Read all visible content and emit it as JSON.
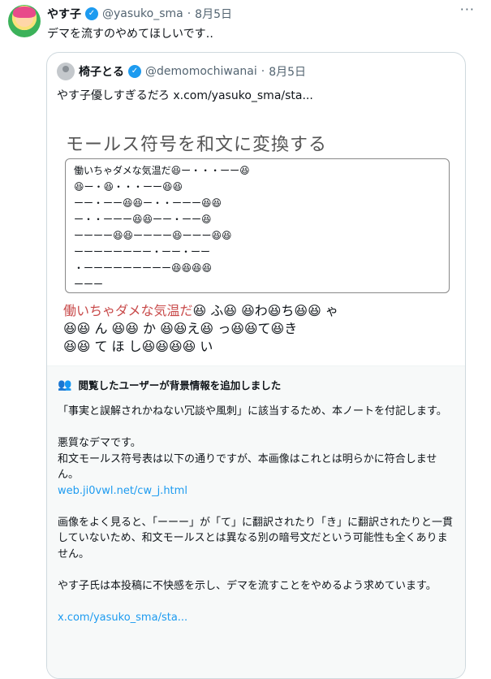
{
  "tweet": {
    "name": "やす子",
    "handle": "@yasuko_sma",
    "date": "8月5日",
    "text": "デマを流すのやめてほしいです‥"
  },
  "quote": {
    "name": "椅子とる",
    "handle": "@demomochiwanai",
    "date": "8月5日",
    "text": "やす子優しすぎるだろ  x.com/yasuko_sma/sta...",
    "image": {
      "title": "モールス符号を和文に変換する",
      "code_lines": [
        "働いちゃダメな気温だ😆ー・・・ーー😆",
        "😆ー・😆・・・ーー😆😆",
        "ーー・ーー😆😆ー・・ーーー😆😆",
        "ー・・ーーー😆😆ーー・ーー😆",
        "ーーーー😆😆ーーーー😆ーーー😆😆",
        "ーーーーーーーー・ーー・ーー",
        "・ーーーーーーーーー😆😆😆😆",
        "ーーー"
      ],
      "result_red": "働いちゃダメな気温だ",
      "result_rest_1": "😆 ふ😆   😆わ😆ち😆😆   ゃ",
      "result_rest_2": "😆😆  ん  😆😆   か  😆😆え😆  っ😆😆て😆き",
      "result_rest_3": "😆😆  て  ほ  し😆😆😆😆   い"
    },
    "note": {
      "header": "閲覧したユーザーが背景情報を追加しました",
      "p1": "「事実と誤解されかねない冗談や風刺」に該当するため、本ノートを付記します。",
      "p2": "悪質なデマです。\n和文モールス符号表は以下の通りですが、本画像はこれとは明らかに符合しません。",
      "link1": "web.ji0vwl.net/cw_j.html",
      "p3": "画像をよく見ると、「ーーー」が「て」に翻訳されたり「き」に翻訳されたりと一貫していないため、和文モールスとは異なる別の暗号文だという可能性も全くありません。",
      "p4": "やす子氏は本投稿に不快感を示し、デマを流すことをやめるよう求めています。",
      "link2": "x.com/yasuko_sma/sta..."
    }
  }
}
